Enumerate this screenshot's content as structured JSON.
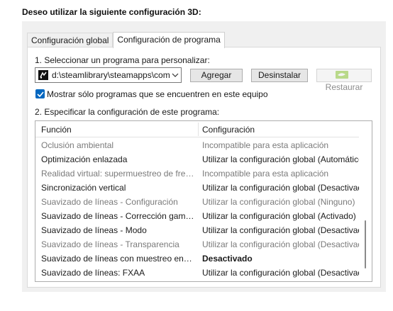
{
  "heading": "Deseo utilizar la siguiente configuración 3D:",
  "tabs": [
    {
      "label": "Configuración global"
    },
    {
      "label": "Configuración de programa"
    }
  ],
  "step1": {
    "label": "1. Seleccionar un programa para personalizar:",
    "program": "d:\\steamlibrary\\steamapps\\com...",
    "add_label": "Agregar",
    "uninstall_label": "Desinstalar",
    "restore_label": "Restaurar"
  },
  "show_only": {
    "label": "Mostrar sólo programas que se encuentren en este equipo",
    "checked": true
  },
  "step2": {
    "label": "2. Especificar la configuración de este programa:"
  },
  "table": {
    "col_function": "Función",
    "col_setting": "Configuración",
    "rows": [
      {
        "function": "Oclusión ambiental",
        "setting": "Incompatible para esta aplicación",
        "state": "disabled"
      },
      {
        "function": "Optimización enlazada",
        "setting": "Utilizar la configuración global (Automático)",
        "state": "normal"
      },
      {
        "function": "Realidad virtual: supermuestreo de frecue...",
        "setting": "Incompatible para esta aplicación",
        "state": "disabled"
      },
      {
        "function": "Sincronización vertical",
        "setting": "Utilizar la configuración global (Desactivado)",
        "state": "normal"
      },
      {
        "function": "Suavizado de líneas - Configuración",
        "setting": "Utilizar la configuración global (Ninguno)",
        "state": "disabled"
      },
      {
        "function": "Suavizado de líneas - Corrección gamma",
        "setting": "Utilizar la configuración global (Activado)",
        "state": "normal"
      },
      {
        "function": "Suavizado de líneas - Modo",
        "setting": "Utilizar la configuración global (Desactivado)",
        "state": "normal"
      },
      {
        "function": "Suavizado de líneas - Transparencia",
        "setting": "Utilizar la configuración global (Desactivado)",
        "state": "disabled"
      },
      {
        "function": "Suavizado de líneas con muestreo en múlti...",
        "setting": "Desactivado",
        "state": "bold"
      },
      {
        "function": "Suavizado de líneas: FXAA",
        "setting": "Utilizar la configuración global (Desactivado)",
        "state": "normal"
      }
    ]
  },
  "colors": {
    "accent": "#0067c0",
    "nvidia_green": "#76b900",
    "disabled_text": "#7a7a7a"
  },
  "icons": [
    "app-icon",
    "chevron-down-icon",
    "nvidia-icon",
    "checkmark-icon"
  ]
}
